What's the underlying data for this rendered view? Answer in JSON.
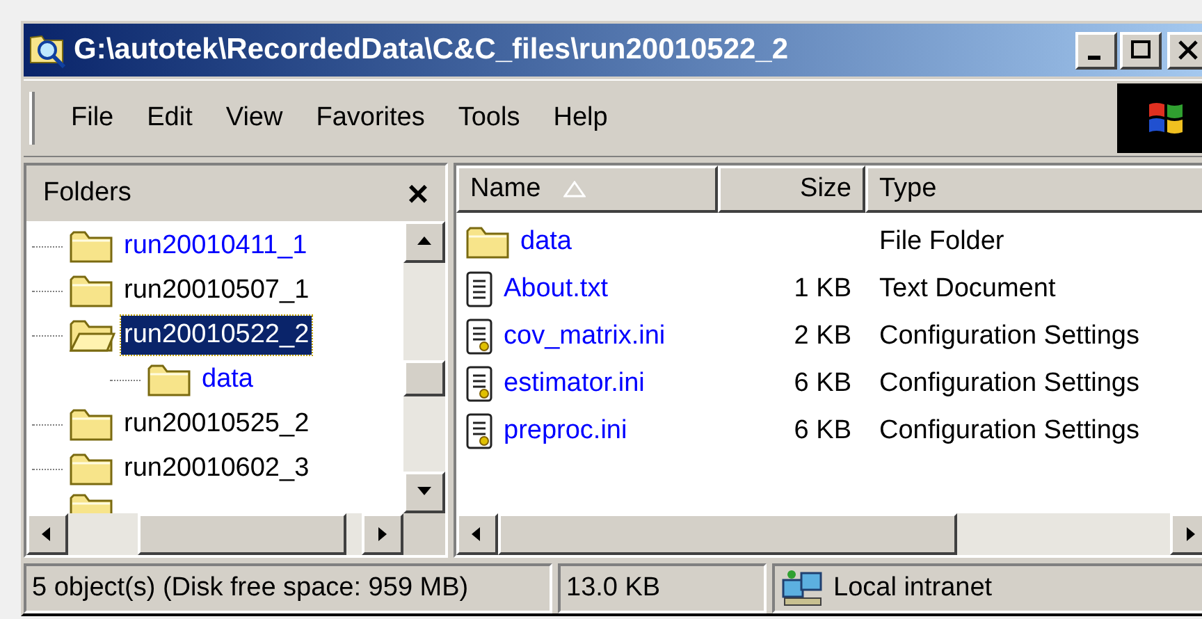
{
  "window": {
    "title": "G:\\autotek\\RecordedData\\C&C_files\\run20010522_2"
  },
  "menu": [
    "File",
    "Edit",
    "View",
    "Favorites",
    "Tools",
    "Help"
  ],
  "folders_pane": {
    "title": "Folders",
    "close": "×",
    "tree": [
      {
        "label": "run20010411_1",
        "compressed": true,
        "selected": false,
        "expanded": false
      },
      {
        "label": "run20010507_1",
        "compressed": false,
        "selected": false,
        "expanded": false
      },
      {
        "label": "run20010522_2",
        "compressed": false,
        "selected": true,
        "expanded": true,
        "children": [
          {
            "label": "data",
            "compressed": true,
            "selected": false,
            "expanded": false
          }
        ]
      },
      {
        "label": "run20010525_2",
        "compressed": false,
        "selected": false,
        "expanded": false
      },
      {
        "label": "run20010602_3",
        "compressed": false,
        "selected": false,
        "expanded": false
      }
    ]
  },
  "file_list": {
    "columns": [
      "Name",
      "Size",
      "Type"
    ],
    "rows": [
      {
        "kind": "folder",
        "name": "data",
        "size": "",
        "type": "File Folder",
        "compressed": true
      },
      {
        "kind": "text",
        "name": "About.txt",
        "size": "1 KB",
        "type": "Text Document",
        "compressed": true
      },
      {
        "kind": "ini",
        "name": "cov_matrix.ini",
        "size": "2 KB",
        "type": "Configuration Settings",
        "compressed": true
      },
      {
        "kind": "ini",
        "name": "estimator.ini",
        "size": "6 KB",
        "type": "Configuration Settings",
        "compressed": true
      },
      {
        "kind": "ini",
        "name": "preproc.ini",
        "size": "6 KB",
        "type": "Configuration Settings",
        "compressed": true
      }
    ]
  },
  "status_bar": {
    "objects": "5 object(s) (Disk free space: 959 MB)",
    "size": "13.0 KB",
    "zone": "Local intranet"
  }
}
